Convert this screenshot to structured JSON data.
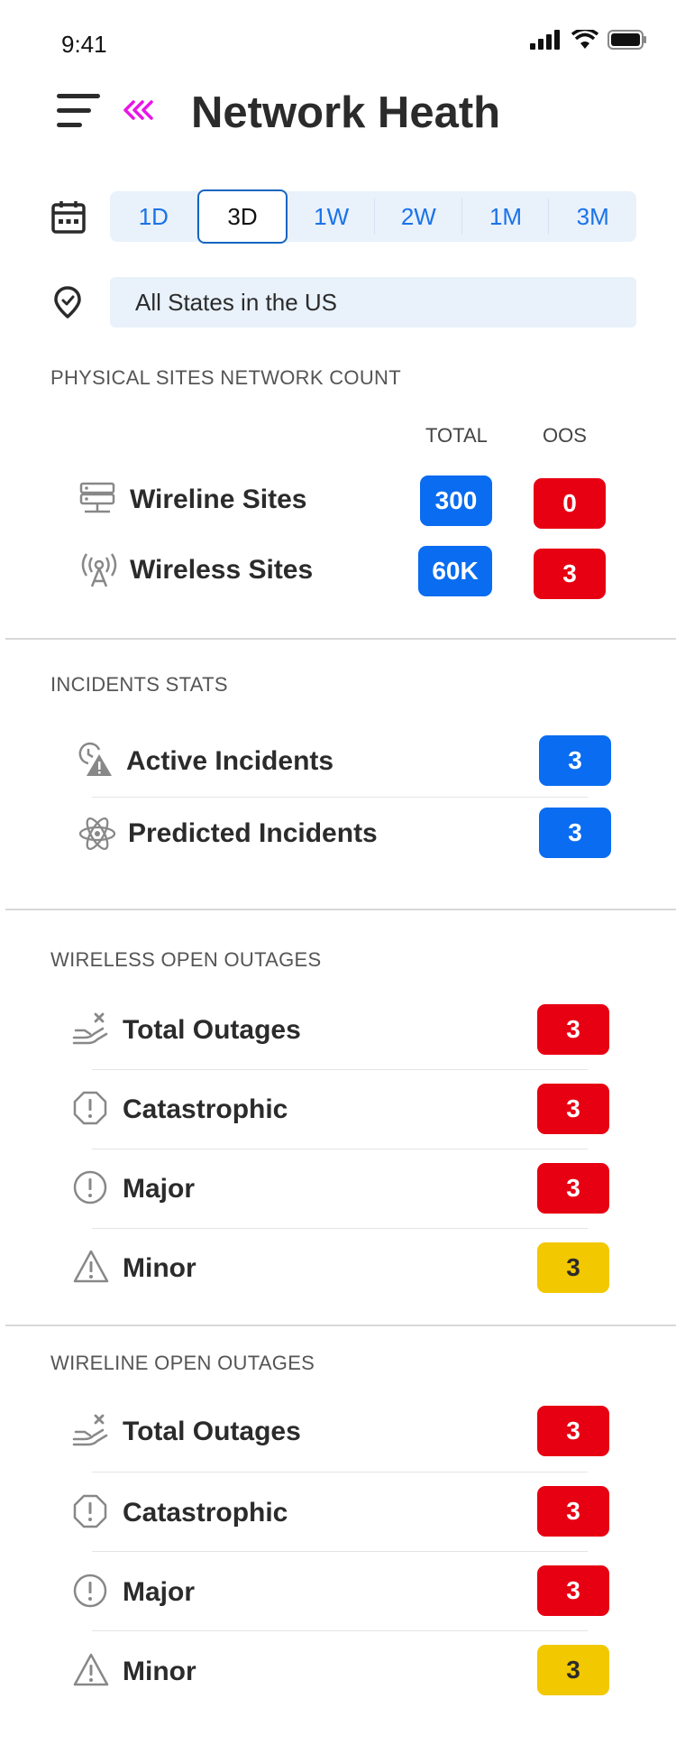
{
  "status": {
    "time": "9:41"
  },
  "header": {
    "title": "Network Heath"
  },
  "filters": {
    "ranges": [
      "1D",
      "3D",
      "1W",
      "2W",
      "1M",
      "3M"
    ],
    "selected_range": "3D",
    "location": "All States in the US"
  },
  "physical": {
    "title": "PHYSICAL SITES NETWORK COUNT",
    "col_total": "TOTAL",
    "col_oos": "OOS",
    "rows": [
      {
        "label": "Wireline Sites",
        "icon": "server-icon",
        "total": "300",
        "oos": "0"
      },
      {
        "label": "Wireless Sites",
        "icon": "antenna-icon",
        "total": "60K",
        "oos": "3"
      }
    ]
  },
  "incidents": {
    "title": "INCIDENTS STATS",
    "rows": [
      {
        "label": "Active Incidents",
        "icon": "incident-alert-icon",
        "value": "3"
      },
      {
        "label": "Predicted Incidents",
        "icon": "atom-icon",
        "value": "3"
      }
    ]
  },
  "wireless": {
    "title": "WIRELESS OPEN OUTAGES",
    "rows": [
      {
        "label": "Total Outages",
        "icon": "outage-hand-icon",
        "value": "3",
        "color": "#e60012"
      },
      {
        "label": "Catastrophic",
        "icon": "octagon-alert-icon",
        "value": "3",
        "color": "#e60012"
      },
      {
        "label": "Major",
        "icon": "circle-alert-icon",
        "value": "3",
        "color": "#e60012"
      },
      {
        "label": "Minor",
        "icon": "triangle-alert-icon",
        "value": "3",
        "color": "#f2c800"
      }
    ]
  },
  "wireline": {
    "title": "WIRELINE OPEN OUTAGES",
    "rows": [
      {
        "label": "Total Outages",
        "icon": "outage-hand-icon",
        "value": "3",
        "color": "#e60012"
      },
      {
        "label": "Catastrophic",
        "icon": "octagon-alert-icon",
        "value": "3",
        "color": "#e60012"
      },
      {
        "label": "Major",
        "icon": "circle-alert-icon",
        "value": "3",
        "color": "#e60012"
      },
      {
        "label": "Minor",
        "icon": "triangle-alert-icon",
        "value": "3",
        "color": "#f2c800"
      }
    ]
  },
  "colors": {
    "accent": "#0a6cf0",
    "danger": "#e60012",
    "warning": "#f2c800",
    "back_arrow": "#e815e8"
  }
}
